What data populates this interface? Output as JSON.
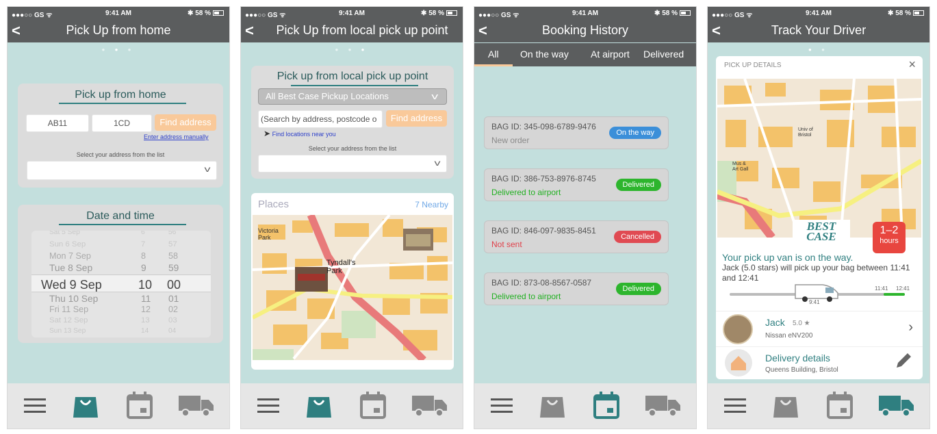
{
  "status": {
    "carrier": "●●●○○ GS ᯤ",
    "time": "9:41 AM",
    "battery": "✱ 58 %"
  },
  "screen1": {
    "title": "Pick Up from home",
    "card_heading": "Pick up from home",
    "postcode1": "AB11",
    "postcode2": "1CD",
    "find_button": "Find address",
    "manual_link": "Enter address manually",
    "select_hint": "Select your address from the list",
    "date_heading": "Date and time",
    "picker": [
      {
        "day": "Sat 5 Sep",
        "h": "6",
        "m": "56"
      },
      {
        "day": "Sun 6 Sep",
        "h": "7",
        "m": "57"
      },
      {
        "day": "Mon 7 Sep",
        "h": "8",
        "m": "58"
      },
      {
        "day": "Tue 8 Sep",
        "h": "9",
        "m": "59"
      },
      {
        "day": "Wed 9 Sep",
        "h": "10",
        "m": "00"
      },
      {
        "day": "Thu 10 Sep",
        "h": "11",
        "m": "01"
      },
      {
        "day": "Fri 11 Sep",
        "h": "12",
        "m": "02"
      },
      {
        "day": "Sat 12 Sep",
        "h": "13",
        "m": "03"
      },
      {
        "day": "Sun 13 Sep",
        "h": "14",
        "m": "04"
      }
    ]
  },
  "screen2": {
    "title": "Pick Up from local pick up point",
    "card_heading": "Pick up from local pick up point",
    "dropdown_value": "All Best Case Pickup Locations",
    "search_placeholder": "(Search by address, postcode o",
    "find_button": "Find address",
    "near_link": "Find locations near you",
    "select_hint": "Select your address from the list",
    "places_label": "Places",
    "nearby_count": "7 Nearby",
    "map_labels": [
      "Victoria Park",
      "Tyndall's Park"
    ]
  },
  "screen3": {
    "title": "Booking History",
    "tabs": [
      "All",
      "On the way",
      "At airport",
      "Delivered"
    ],
    "bookings": [
      {
        "id": "BAG ID: 345-098-6789-9476",
        "status": "New order",
        "status_color": "#8a8a8a",
        "pill": "On the way",
        "pill_color": "#3b8fd9"
      },
      {
        "id": "BAG ID: 386-753-8976-8745",
        "status": "Delivered to airport",
        "status_color": "#21b021",
        "pill": "Delivered",
        "pill_color": "#2db52d"
      },
      {
        "id": "BAG ID: 846-097-9835-8451",
        "status": "Not sent",
        "status_color": "#e0404a",
        "pill": "Cancelled",
        "pill_color": "#e04a52"
      },
      {
        "id": "BAG ID: 873-08-8567-0587",
        "status": "Delivered to airport",
        "status_color": "#21b021",
        "pill": "Delivered",
        "pill_color": "#2db52d"
      }
    ]
  },
  "screen4": {
    "title": "Track Your Driver",
    "details_label": "PICK UP DETAILS",
    "close": "×",
    "map_labels": [
      "Univ of Bristol",
      "Mus & Art Gall"
    ],
    "logo_text": "BEST CASE",
    "eta_range": "1–2",
    "eta_unit": "hours",
    "headline": "Your pick up van is on the way.",
    "message": "Jack (5.0 stars) will pick up your bag between 11:41 and 12:41",
    "progress_start": "9:41",
    "progress_t1": "11:41",
    "progress_t2": "12:41",
    "progress_fraction": 0.6,
    "driver_name": "Jack",
    "driver_rating": "5.0 ★",
    "driver_vehicle": "Nissan  eNV200",
    "delivery_label": "Delivery details",
    "delivery_address": "Queens Building, Bristol"
  },
  "colors": {
    "accent": "#2f7f80",
    "orange": "#f9c99a",
    "teal_bg": "#c3dfdd",
    "bar": "#5b5d5e"
  }
}
